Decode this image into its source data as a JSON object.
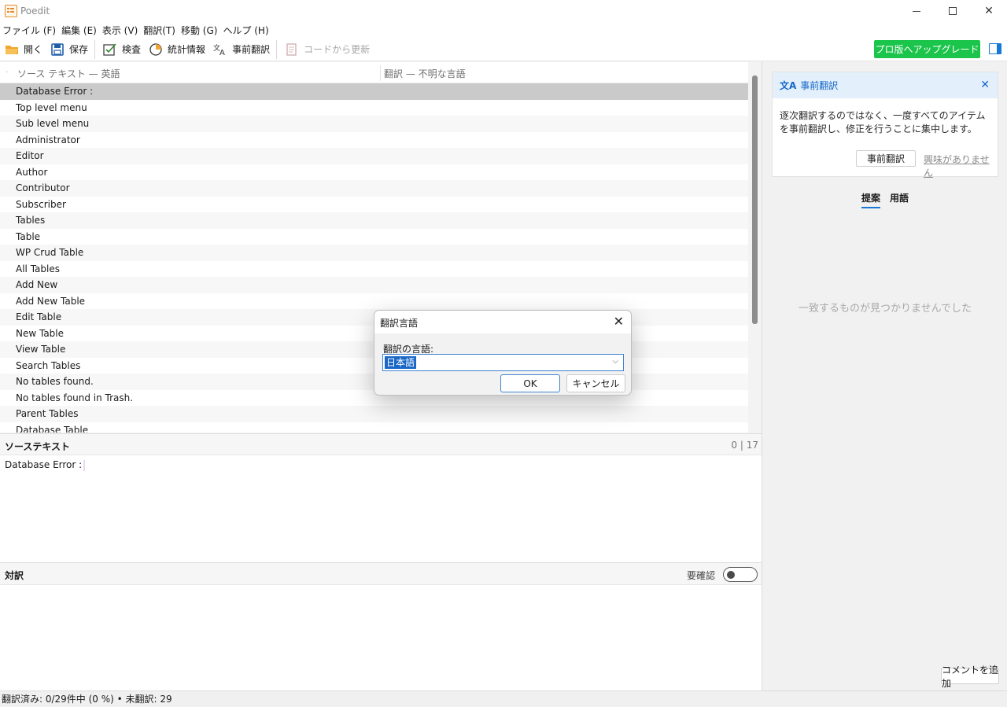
{
  "window": {
    "title": "Poedit"
  },
  "menu": [
    "ファイル (F)",
    "編集 (E)",
    "表示 (V)",
    "翻訳(T)",
    "移動 (G)",
    "ヘルプ (H)"
  ],
  "toolbar": {
    "open": "開く",
    "save": "保存",
    "validate": "検査",
    "stats": "統計情報",
    "pretranslate": "事前翻訳",
    "update_from_code": "コードから更新",
    "upgrade": "プロ版へアップグレード"
  },
  "list": {
    "dot": "·",
    "source_header": "ソース テキスト — 英語",
    "translation_header": "翻訳 — 不明な言語",
    "rows": [
      "Database Error :",
      "Top level menu",
      "Sub level menu",
      "Administrator",
      "Editor",
      "Author",
      "Contributor",
      "Subscriber",
      "Tables",
      "Table",
      "WP Crud Table",
      "All Tables",
      "Add New",
      "Add New Table",
      "Edit Table",
      "New Table",
      "View Table",
      "Search Tables",
      "No tables found.",
      "No tables found in Trash.",
      "Parent Tables",
      "Database Table"
    ]
  },
  "source_panel": {
    "title": "ソーステキスト",
    "count": "0 | 17",
    "text": "Database Error :"
  },
  "translation_panel": {
    "title": "対訳",
    "fuzzy_label": "要確認"
  },
  "pretranslate_card": {
    "icon_glyph": "文A",
    "title": "事前翻訳",
    "description": "逐次翻訳するのではなく、一度すべてのアイテムを事前翻訳し、修正を行うことに集中します。",
    "button": "事前翻訳",
    "dismiss": "興味がありません"
  },
  "sidebar_tabs": [
    "提案",
    "用語"
  ],
  "no_matches": "一致するものが見つかりませんでした",
  "add_comment": "コメントを追加",
  "status": "翻訳済み: 0/29件中 (0 %)  •  未翻訳: 29",
  "dialog": {
    "title": "翻訳言語",
    "label": "翻訳の言語:",
    "value": "日本語",
    "ok": "OK",
    "cancel": "キャンセル"
  },
  "colors": {
    "accent": "#1778d6",
    "upgrade": "#1bc44b",
    "selected_row": "#cacaca"
  }
}
